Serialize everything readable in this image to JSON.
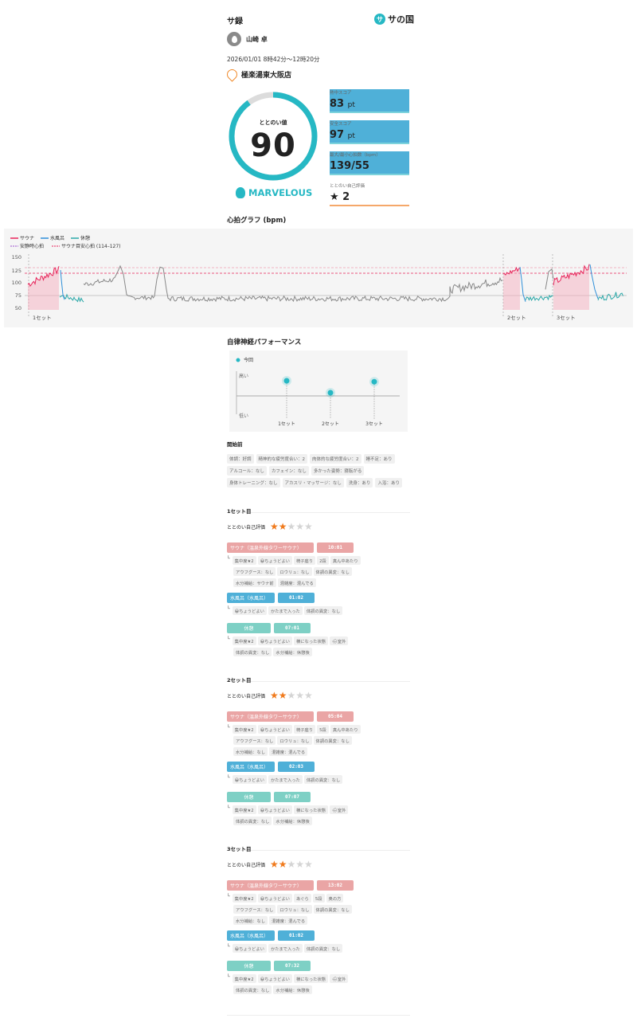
{
  "header": {
    "title": "サ録",
    "brand": "サの国",
    "user_name": "山崎 卓",
    "datetime": "2026/01/01 8時42分〜12時20分",
    "facility": "極楽湯東大阪店"
  },
  "totonoi": {
    "label": "ととのい値",
    "value": "90",
    "value_fraction": 0.9,
    "rank": "MARVELOUS"
  },
  "scores": [
    {
      "label": "熱中スコア",
      "value": "83",
      "unit": "pt"
    },
    {
      "label": "安全スコア",
      "value": "97",
      "unit": "pt"
    },
    {
      "label": "最大/最小心拍数（bpm）",
      "value": "139/55",
      "unit": ""
    },
    {
      "label": "ととのい自己評価",
      "value": "★ 2",
      "unit": ""
    }
  ],
  "hr_graph": {
    "title": "心拍グラフ (bpm)",
    "legend": [
      "サウナ",
      "水風呂",
      "休憩",
      "安静時心拍",
      "サウナ目安心拍 (114–127)"
    ],
    "y_ticks": [
      "150",
      "125",
      "100",
      "75",
      "50"
    ],
    "set_labels": [
      "1セット",
      "2セット",
      "3セット"
    ],
    "colors": {
      "sauna": "#e8245a",
      "water": "#2e8fd8",
      "rest": "#2aa8a8",
      "baseline": "#888888"
    }
  },
  "anp": {
    "title": "自律神経パフォーマンス",
    "legend": "今回",
    "y_high": "高い",
    "y_low": "低い",
    "x_labels": [
      "1セット",
      "2セット",
      "3セット"
    ],
    "values": [
      0.7,
      0.45,
      0.68
    ]
  },
  "before": {
    "title": "開始前",
    "chips": [
      "体調：好調",
      "精神的な疲労度合い：2",
      "肉体的な疲労度合い：2",
      "睡不足：あり",
      "アルコール：なし",
      "カフェイン：なし",
      "多かった姿勢：寝転がる",
      "身体トレーニング：なし",
      "アカスリ・マッサージ：なし",
      "洗身：あり",
      "入浴：あり"
    ]
  },
  "sets": [
    {
      "title": "1セット目",
      "rating_label": "ととのい自己評価",
      "stars": 2,
      "sauna": {
        "name": "サウナ（温泉外線タワーサウナ）",
        "time": "10:01",
        "row1": [
          "集中度★2",
          "😀ちょうどよい",
          "椅子座り",
          "2段",
          "真ん中あたり"
        ],
        "row2": [
          "アウフグース：なし",
          "ロウリュ：なし",
          "体調の異変：なし"
        ],
        "row3": [
          "水分補給：サウナ前",
          "混雑度：混んでる"
        ]
      },
      "water": {
        "name": "水風呂（水風呂）",
        "time": "01:02",
        "row1": [
          "😀ちょうどよい",
          "かたまで入った",
          "体調の異変：なし"
        ]
      },
      "rest": {
        "name": "休憩",
        "time": "07:01",
        "row1": [
          "集中度★2",
          "😀ちょうどよい",
          "横になった状態",
          "🌧室外"
        ],
        "row2": [
          "体調の異変：なし",
          "水分補給：休憩後"
        ]
      }
    },
    {
      "title": "2セット目",
      "rating_label": "ととのい自己評価",
      "stars": 2,
      "sauna": {
        "name": "サウナ（温泉外線タワーサウナ）",
        "time": "05:04",
        "row1": [
          "集中度★2",
          "😀ちょうどよい",
          "椅子座り",
          "5段",
          "真ん中あたり"
        ],
        "row2": [
          "アウフグース：なし",
          "ロウリュ：なし",
          "体調の異変：なし"
        ],
        "row3": [
          "水分補給：なし",
          "混雑度：混んでる"
        ]
      },
      "water": {
        "name": "水風呂（水風呂）",
        "time": "02:03",
        "row1": [
          "😀ちょうどよい",
          "かたまで入った",
          "体調の異変：なし"
        ]
      },
      "rest": {
        "name": "休憩",
        "time": "07:07",
        "row1": [
          "集中度★2",
          "😀ちょうどよい",
          "横になった状態",
          "🌧室外"
        ],
        "row2": [
          "体調の異変：なし",
          "水分補給：休憩後"
        ]
      }
    },
    {
      "title": "3セット目",
      "rating_label": "ととのい自己評価",
      "stars": 2,
      "sauna": {
        "name": "サウナ（温泉外線タワーサウナ）",
        "time": "13:02",
        "row1": [
          "集中度★2",
          "😀ちょうどよい",
          "あぐら",
          "5段",
          "奥の方"
        ],
        "row2": [
          "アウフグース：なし",
          "ロウリュ：なし",
          "体調の異変：なし"
        ],
        "row3": [
          "水分補給：なし",
          "混雑度：混んでる"
        ]
      },
      "water": {
        "name": "水風呂（水風呂）",
        "time": "01:02",
        "row1": [
          "😀ちょうどよい",
          "かたまで入った",
          "体調の異変：なし"
        ]
      },
      "rest": {
        "name": "休憩",
        "time": "07:32",
        "row1": [
          "集中度★2",
          "😀ちょうどよい",
          "横になった状態",
          "🌧室外"
        ],
        "row2": [
          "体調の異変：なし",
          "水分補給：休憩後"
        ]
      }
    }
  ]
}
